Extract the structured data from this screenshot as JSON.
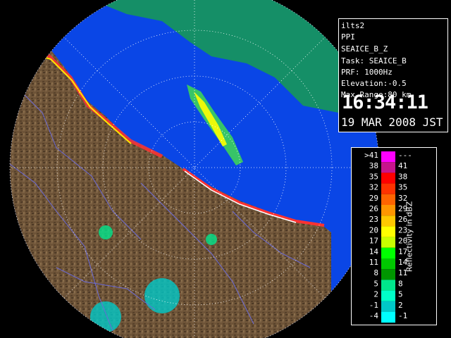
{
  "header": {
    "site": "ilts2",
    "mode": "PPI",
    "product": "SEAICE_B_Z",
    "task": "Task: SEAICE_B",
    "prf": "PRF: 1000Hz",
    "elevation": "Elevation:-0.5",
    "max_range": "Max Range:80 km",
    "time": "16:34:11",
    "date": "19 MAR 2008 JST"
  },
  "legend": {
    "title": "Reflectivity in dBZ",
    "rows": [
      {
        "left": ">41",
        "right": "---",
        "color": "#ff00ff"
      },
      {
        "left": "38",
        "right": "41",
        "color": "#c8148c"
      },
      {
        "left": "35",
        "right": "38",
        "color": "#ff0000"
      },
      {
        "left": "32",
        "right": "35",
        "color": "#ff3200"
      },
      {
        "left": "29",
        "right": "32",
        "color": "#ff6400"
      },
      {
        "left": "26",
        "right": "29",
        "color": "#ff9600"
      },
      {
        "left": "23",
        "right": "26",
        "color": "#ffc800"
      },
      {
        "left": "20",
        "right": "23",
        "color": "#ffff00"
      },
      {
        "left": "17",
        "right": "20",
        "color": "#c8ff00"
      },
      {
        "left": "14",
        "right": "17",
        "color": "#00ff00"
      },
      {
        "left": "11",
        "right": "14",
        "color": "#00c800"
      },
      {
        "left": "8",
        "right": "11",
        "color": "#009600"
      },
      {
        "left": "5",
        "right": "8",
        "color": "#00e68c"
      },
      {
        "left": "2",
        "right": "5",
        "color": "#00ffc8"
      },
      {
        "left": "-1",
        "right": "2",
        "color": "#00c8c8"
      },
      {
        "left": "-4",
        "right": "-1",
        "color": "#00ffff"
      }
    ]
  },
  "colors": {
    "sea": "#0a46e6",
    "land": "#6b5236",
    "range_ring": "#ffffff",
    "rivers": "#6a6ad8"
  }
}
